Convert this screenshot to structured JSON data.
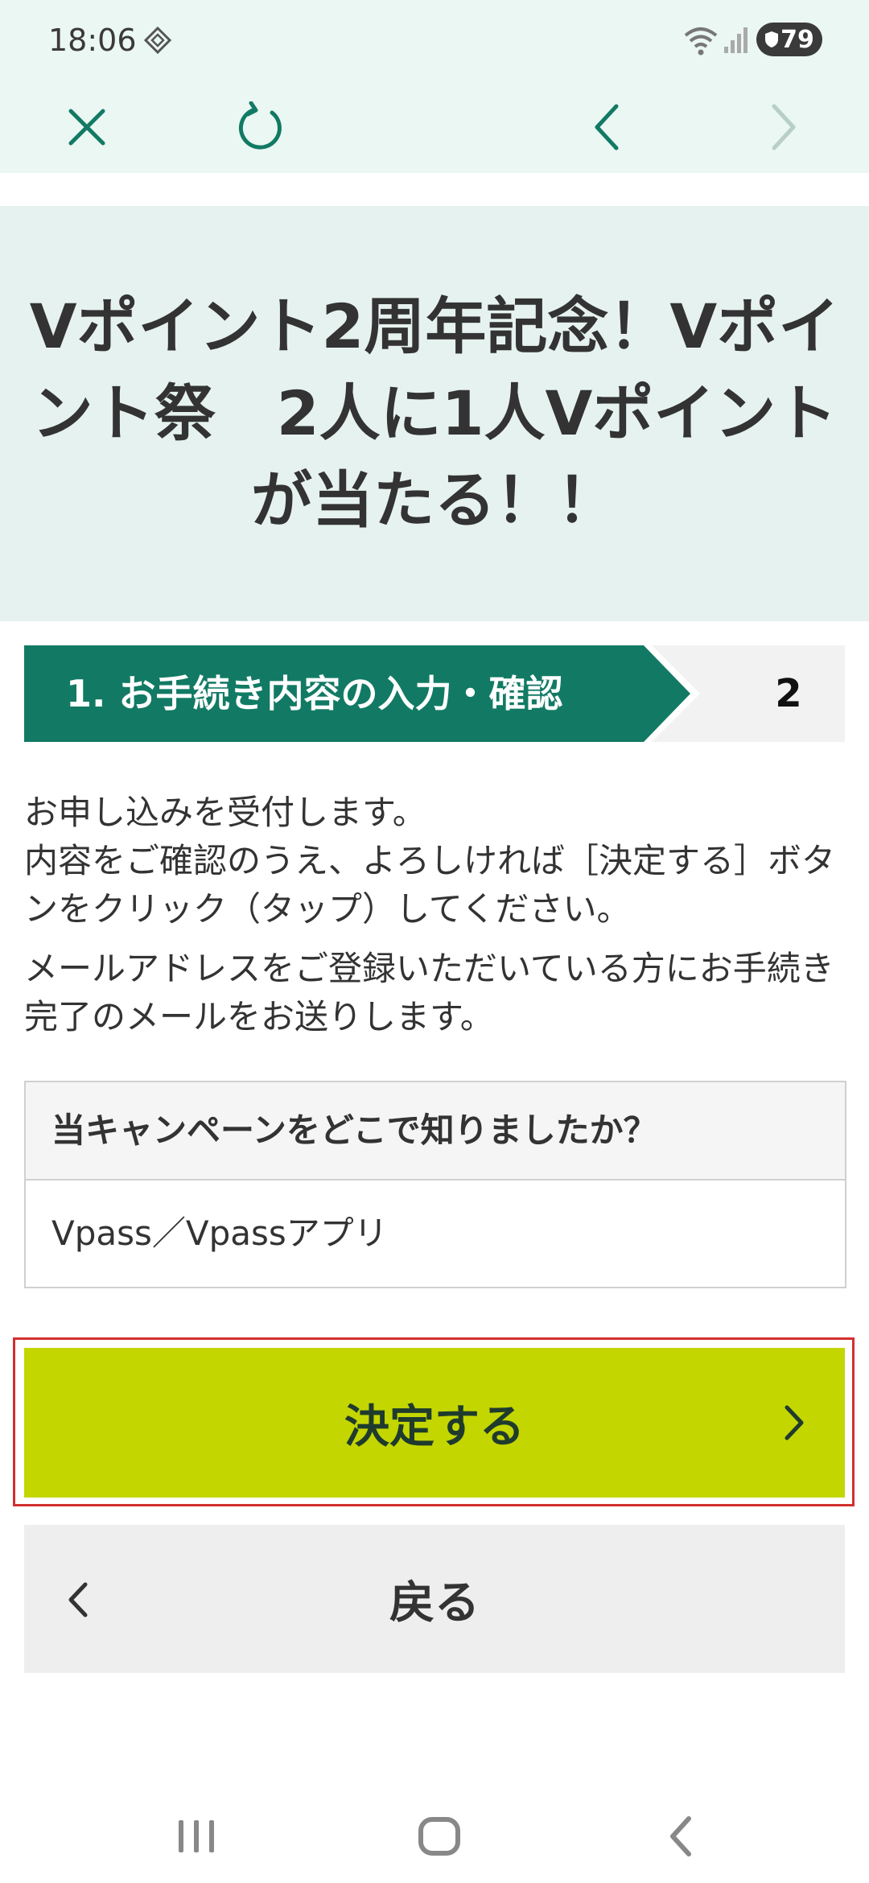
{
  "status_bar": {
    "time": "18:06",
    "battery": "79"
  },
  "title": "Vポイント2周年記念！Vポイント祭　2人に1人Vポイントが当たる！！",
  "steps": {
    "current_label": "1. お手続き内容の入力・確認",
    "next_label": "2"
  },
  "instructions": {
    "paragraph1": "お申し込みを受付します。\n内容をご確認のうえ、よろしければ［決定する］ボタンをクリック（タップ）してください。",
    "paragraph2": "メールアドレスをご登録いただいている方にお手続き完了のメールをお送りします。"
  },
  "survey": {
    "question": "当キャンペーンをどこで知りましたか？",
    "answer": "Vpass／Vpassアプリ"
  },
  "buttons": {
    "confirm_label": "決定する",
    "back_label": "戻る"
  },
  "colors": {
    "accent_green": "#127a64",
    "confirm_lime": "#c3d600",
    "highlight_red": "#d32f2f",
    "header_bg": "#ebf7f2"
  },
  "icons": {
    "close": "close-icon",
    "reload": "reload-icon",
    "back": "chevron-left-icon",
    "forward": "chevron-right-icon"
  }
}
